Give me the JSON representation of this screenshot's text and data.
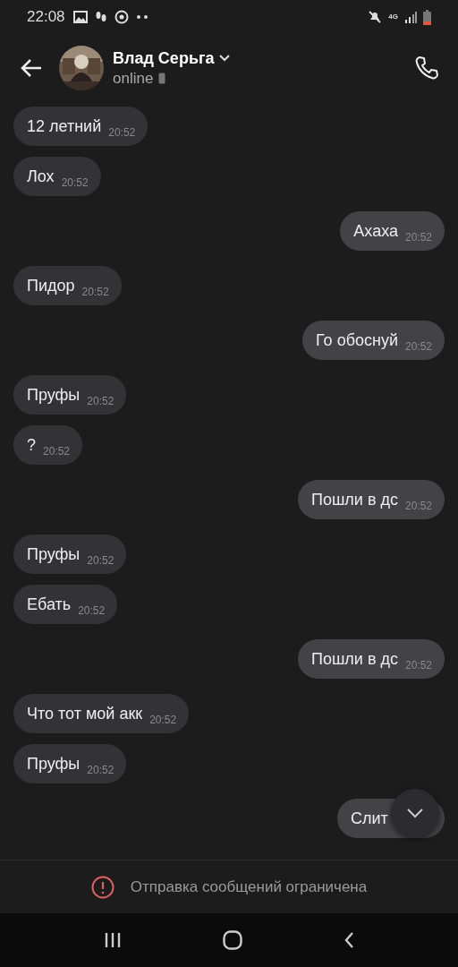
{
  "status_bar": {
    "time": "22:08",
    "network": "4G"
  },
  "header": {
    "name": "Влад Серьга",
    "status": "online"
  },
  "messages": [
    {
      "text": "12 летний",
      "time": "20:52",
      "outgoing": false
    },
    {
      "text": "Лох",
      "time": "20:52",
      "outgoing": false
    },
    {
      "text": "Ахаха",
      "time": "20:52",
      "outgoing": true
    },
    {
      "text": "Пидор",
      "time": "20:52",
      "outgoing": false
    },
    {
      "text": "Го обоснуй",
      "time": "20:52",
      "outgoing": true
    },
    {
      "text": "Пруфы",
      "time": "20:52",
      "outgoing": false
    },
    {
      "text": "?",
      "time": "20:52",
      "outgoing": false
    },
    {
      "text": "Пошли в дс",
      "time": "20:52",
      "outgoing": true
    },
    {
      "text": "Пруфы",
      "time": "20:52",
      "outgoing": false
    },
    {
      "text": "Ебать",
      "time": "20:52",
      "outgoing": false
    },
    {
      "text": "Пошли в дс",
      "time": "20:52",
      "outgoing": true
    },
    {
      "text": "Что тот мой акк",
      "time": "20:52",
      "outgoing": false
    },
    {
      "text": "Пруфы",
      "time": "20:52",
      "outgoing": false
    },
    {
      "text": "Слит",
      "outgoing": true
    }
  ],
  "restriction": {
    "text": "Отправка сообщений ограничена"
  }
}
